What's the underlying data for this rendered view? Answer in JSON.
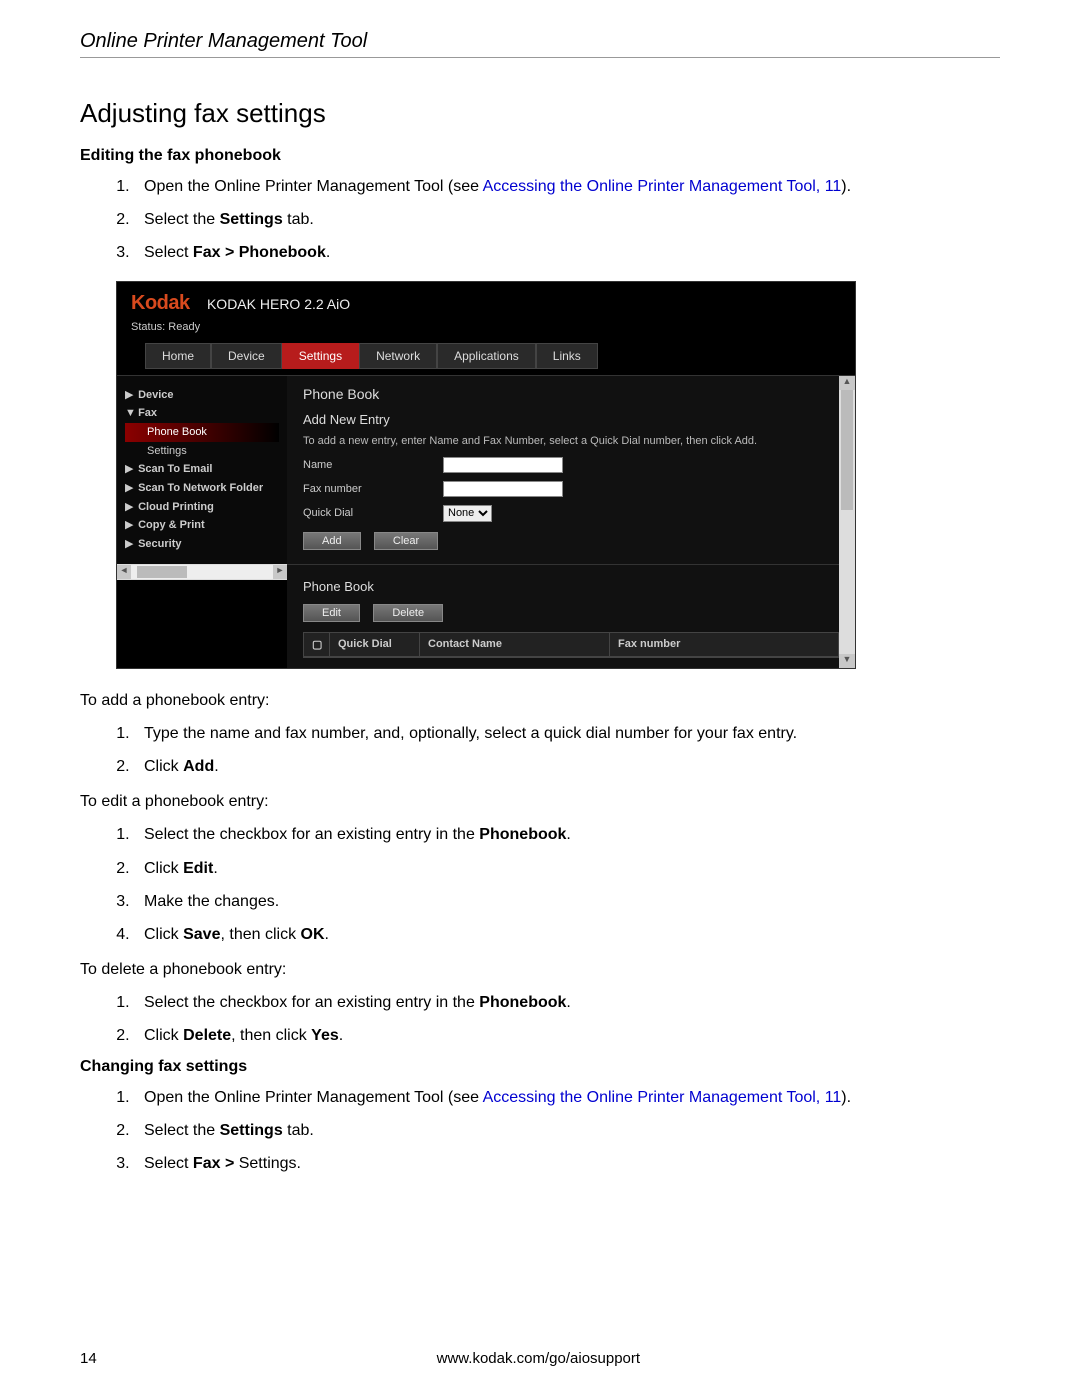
{
  "page_header": "Online Printer Management Tool",
  "section_title": "Adjusting fax settings",
  "subhead1": "Editing the fax phonebook",
  "steps1": {
    "s1_pre": "Open the Online Printer Management Tool (see  ",
    "s1_link": "Accessing the Online Printer Management Tool, 11",
    "s1_post": ").",
    "s2_pre": "Select the ",
    "s2_bold": "Settings",
    "s2_post": " tab.",
    "s3_pre": "Select ",
    "s3_bold": "Fax > Phonebook",
    "s3_post": "."
  },
  "ui": {
    "brand": "Kodak",
    "model": "KODAK HERO 2.2 AiO",
    "status": "Status: Ready",
    "tabs": [
      "Home",
      "Device",
      "Settings",
      "Network",
      "Applications",
      "Links"
    ],
    "active_tab_index": 2,
    "sidebar": {
      "items": [
        {
          "label": "Device",
          "expand": "right"
        },
        {
          "label": "Fax",
          "expand": "down",
          "children": [
            {
              "label": "Phone Book",
              "active": true
            },
            {
              "label": "Settings",
              "active": false
            }
          ]
        },
        {
          "label": "Scan To Email",
          "expand": "right"
        },
        {
          "label": "Scan To Network Folder",
          "expand": "right"
        },
        {
          "label": "Cloud Printing",
          "expand": "right"
        },
        {
          "label": "Copy & Print",
          "expand": "right"
        },
        {
          "label": "Security",
          "expand": "right"
        }
      ]
    },
    "content": {
      "title": "Phone Book",
      "add_heading": "Add New Entry",
      "add_instr": "To add a new entry, enter Name and Fax Number, select a Quick Dial number, then click Add.",
      "name_label": "Name",
      "fax_label": "Fax number",
      "quick_label": "Quick Dial",
      "quick_value": "None",
      "btn_add": "Add",
      "btn_clear": "Clear",
      "pb_heading": "Phone Book",
      "btn_edit": "Edit",
      "btn_delete": "Delete",
      "cols": {
        "quick": "Quick Dial",
        "contact": "Contact Name",
        "fax": "Fax number"
      }
    }
  },
  "para_add": "To add a phonebook entry:",
  "steps_add": {
    "a1": "Type the name and fax number, and, optionally, select a quick dial number for your fax entry.",
    "a2_pre": "Click ",
    "a2_bold": "Add",
    "a2_post": "."
  },
  "para_edit": "To edit a phonebook entry:",
  "steps_edit": {
    "e1_pre": "Select the checkbox for an existing entry in the ",
    "e1_bold": "Phonebook",
    "e1_post": ".",
    "e2_pre": "Click ",
    "e2_bold": "Edit",
    "e2_post": ".",
    "e3": "Make the changes.",
    "e4_pre": "Click ",
    "e4_bold1": "Save",
    "e4_mid": ", then click ",
    "e4_bold2": "OK",
    "e4_post": "."
  },
  "para_del": "To delete a phonebook entry:",
  "steps_del": {
    "d1_pre": "Select the checkbox for an existing entry in the ",
    "d1_bold": "Phonebook",
    "d1_post": ".",
    "d2_pre": "Click ",
    "d2_bold1": "Delete",
    "d2_mid": ", then click ",
    "d2_bold2": "Yes",
    "d2_post": "."
  },
  "subhead2": "Changing fax settings",
  "steps2": {
    "s1_pre": "Open the Online Printer Management Tool (see  ",
    "s1_link": "Accessing the Online Printer Management Tool, 11",
    "s1_post": ").",
    "s2_pre": "Select the ",
    "s2_bold": "Settings",
    "s2_post": " tab.",
    "s3_pre": "Select ",
    "s3_bold": "Fax > ",
    "s3_tail": "Settings."
  },
  "footer": {
    "page": "14",
    "url": "www.kodak.com/go/aiosupport"
  }
}
